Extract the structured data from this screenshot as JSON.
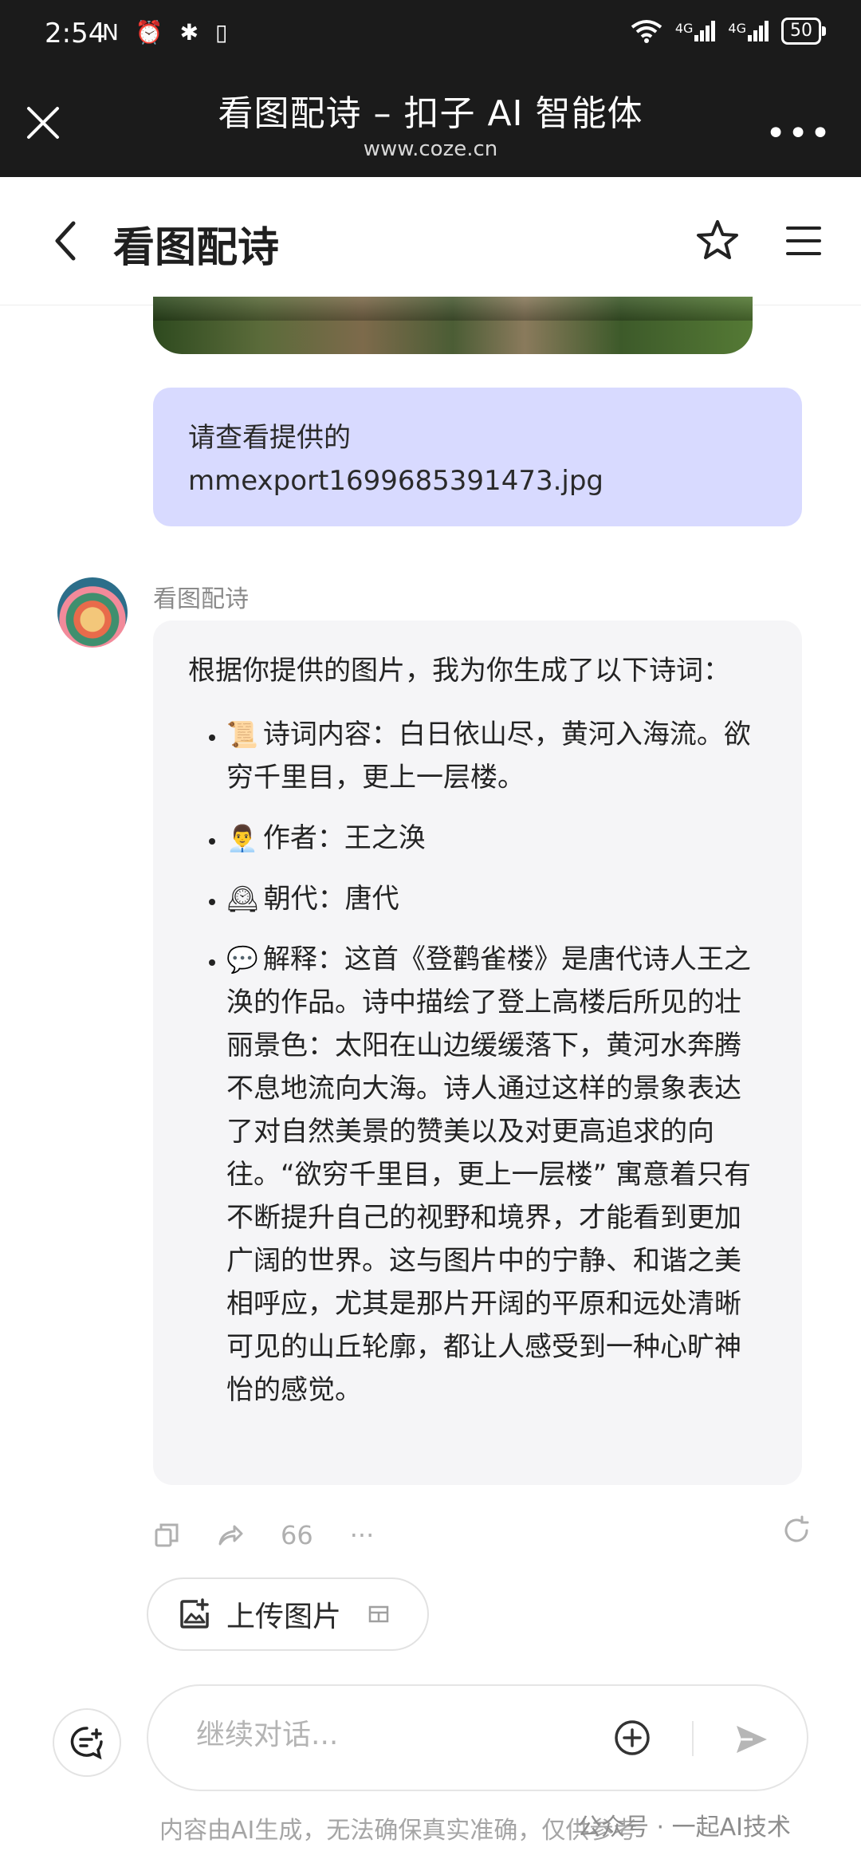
{
  "status_bar": {
    "time": "2:54",
    "left_icons": "N ⏰ ✱ ▯",
    "signal_labels": [
      "4G",
      "4G"
    ],
    "battery": "50"
  },
  "browser": {
    "title": "看图配诗 – 扣子 AI 智能体",
    "url": "www.coze.cn",
    "more": "•••"
  },
  "header": {
    "title": "看图配诗"
  },
  "chat": {
    "user_message": "请查看提供的 mmexport1699685391473.jpg",
    "bot_name": "看图配诗",
    "bot_intro": "根据你提供的图片，我为你生成了以下诗词：",
    "bot_items": [
      {
        "emoji": "📜",
        "text": "诗词内容：白日依山尽，黄河入海流。欲穷千里目，更上一层楼。"
      },
      {
        "emoji": "👨‍💼",
        "text": "作者：王之涣"
      },
      {
        "emoji": "🕰",
        "text": "朝代：唐代"
      },
      {
        "emoji": "💬",
        "text": "解释：这首《登鹳雀楼》是唐代诗人王之涣的作品。诗中描绘了登上高楼后所见的壮丽景色：太阳在山边缓缓落下，黄河水奔腾不息地流向大海。诗人通过这样的景象表达了对自然美景的赞美以及对更高追求的向往。“欲穷千里目，更上一层楼” 寓意着只有不断提升自己的视野和境界，才能看到更加广阔的世界。这与图片中的宁静、和谐之美相呼应，尤其是那片开阔的平原和远处清晰可见的山丘轮廓，都让人感受到一种心旷神怡的感觉。"
      }
    ],
    "action_quote": "66",
    "action_more": "···"
  },
  "upload_chip": {
    "label": "上传图片"
  },
  "input": {
    "placeholder": "继续对话..."
  },
  "footer": {
    "disclaimer": "内容由AI生成，无法确保真实准确，仅供参考",
    "watermark": "公众号 · 一起AI技术"
  }
}
